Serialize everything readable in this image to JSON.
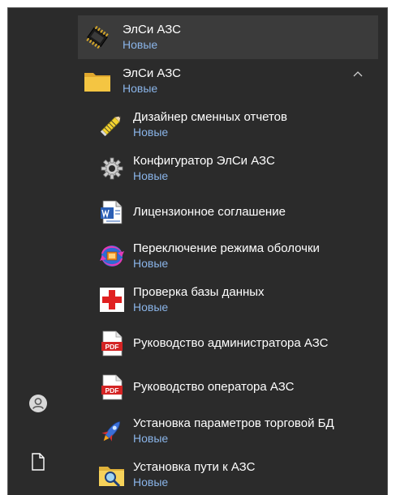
{
  "rail": {
    "items": [
      {
        "name": "account-icon"
      },
      {
        "name": "document-icon"
      }
    ]
  },
  "menu": {
    "items": [
      {
        "title": "ЭлСи АЗС",
        "badge": "Новые",
        "icon": "chip-icon"
      },
      {
        "title": "ЭлСи АЗС",
        "badge": "Новые",
        "icon": "folder-icon"
      },
      {
        "title": "Дизайнер сменных отчетов",
        "badge": "Новые",
        "icon": "pencil-icon"
      },
      {
        "title": "Конфигуратор ЭлСи АЗС",
        "badge": "Новые",
        "icon": "gear-icon"
      },
      {
        "title": "Лицензионное соглашение",
        "icon": "word-document-icon"
      },
      {
        "title": "Переключение режима оболочки",
        "badge": "Новые",
        "icon": "switch-mode-icon"
      },
      {
        "title": "Проверка базы данных",
        "badge": "Новые",
        "icon": "red-cross-icon"
      },
      {
        "title": "Руководство администратора АЗС",
        "icon": "pdf-icon"
      },
      {
        "title": "Руководство оператора АЗС",
        "icon": "pdf-icon"
      },
      {
        "title": "Установка параметров торговой БД",
        "badge": "Новые",
        "icon": "rocket-icon"
      },
      {
        "title": "Установка пути к АЗС",
        "badge": "Новые",
        "icon": "search-folder-icon"
      }
    ]
  },
  "colors": {
    "background": "#2b2b2b",
    "hover": "#3b3b3b",
    "badge": "#8ab4e8",
    "text": "#ffffff"
  }
}
